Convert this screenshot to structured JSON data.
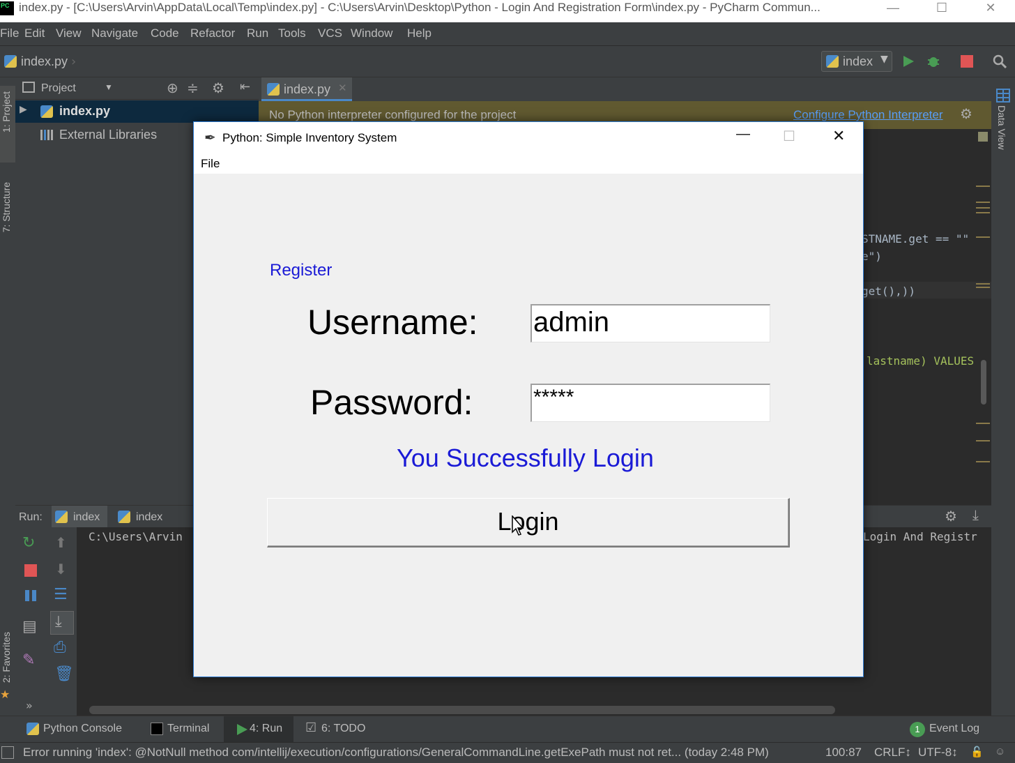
{
  "window": {
    "title": "index.py - [C:\\Users\\Arvin\\AppData\\Local\\Temp\\index.py] - C:\\Users\\Arvin\\Desktop\\Python - Login And Registration Form\\index.py - PyCharm Commun...",
    "logo": "PC"
  },
  "menu": [
    "File",
    "Edit",
    "View",
    "Navigate",
    "Code",
    "Refactor",
    "Run",
    "Tools",
    "VCS",
    "Window",
    "Help"
  ],
  "nav": {
    "breadcrumb": "index.py",
    "run_config": "index"
  },
  "sidebar_left": {
    "project": "1: Project",
    "structure": "7: Structure",
    "favorites": "2: Favorites"
  },
  "sidebar_right": {
    "data_view": "Data View"
  },
  "project_panel": {
    "title": "Project",
    "items": [
      {
        "label": "index.py"
      },
      {
        "label": "External Libraries"
      }
    ]
  },
  "editor": {
    "tab": "index.py",
    "warning": "No Python interpreter configured for the project",
    "warning_link": "Configure Python Interpreter",
    "code_lines": [
      "STNAME.get == \"\"",
      "e\")",
      "get(),))",
      "lastname) VALUES"
    ]
  },
  "run_panel": {
    "label": "Run:",
    "tabs": [
      "index",
      "index"
    ],
    "console_left": "C:\\Users\\Arvin",
    "console_right": "Login And Registr"
  },
  "bottom_tabs": {
    "python_console": "Python Console",
    "terminal": "Terminal",
    "run": "4: Run",
    "todo": "6: TODO",
    "event_log": "Event Log",
    "event_count": "1"
  },
  "status": {
    "message": "Error running 'index': @NotNull method com/intellij/execution/configurations/GeneralCommandLine.getExePath must not ret... (today 2:48 PM)",
    "position": "100:87",
    "line_sep": "CRLF↕",
    "encoding": "UTF-8↕"
  },
  "app": {
    "title": "Python: Simple Inventory System",
    "menu": "File",
    "register_link": "Register",
    "username_label": "Username:",
    "username_value": "admin",
    "password_label": "Password:",
    "password_value": "*****",
    "message": "You Successfully Login",
    "login_button": "Login"
  },
  "colors": {
    "accent_blue": "#1a1ad6",
    "pycharm_bg": "#2b2b2b",
    "panel": "#3c3f41",
    "warning_bg": "#605930"
  }
}
